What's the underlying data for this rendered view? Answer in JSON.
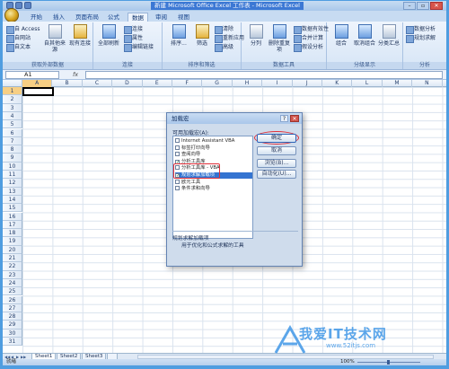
{
  "window": {
    "title": "新建 Microsoft Office Excel 工作表 - Microsoft Excel",
    "minimize": "–",
    "restore": "▫",
    "close": "✕"
  },
  "tabs": [
    "开始",
    "插入",
    "页面布局",
    "公式",
    "数据",
    "审阅",
    "视图"
  ],
  "active_tab": "数据",
  "ribbon": {
    "group1": {
      "items": [
        "自 Access",
        "自网站",
        "自文本"
      ],
      "big": "自其他来源",
      "big2": "现有连接",
      "label": "获取外部数据"
    },
    "group2": {
      "big": "全部刷新",
      "items": [
        "连接",
        "属性",
        "编辑链接"
      ],
      "label": "连接"
    },
    "group3": {
      "big": "排序...",
      "items": [
        "清除",
        "重新应用",
        "高级"
      ],
      "filter": "筛选",
      "label": "排序和筛选"
    },
    "group4": {
      "big1": "分列",
      "big2": "删除重复项",
      "items": [
        "数据有效性",
        "合并计算",
        "假设分析"
      ],
      "label": "数据工具"
    },
    "group5": {
      "big1": "组合",
      "big2": "取消组合",
      "big3": "分类汇总",
      "label": "分级显示"
    },
    "group6": {
      "items": [
        "数据分析",
        "规划求解"
      ],
      "label": "分析"
    }
  },
  "formula_bar": {
    "name_box": "A1",
    "fx": "fx",
    "value": ""
  },
  "columns": [
    "A",
    "B",
    "C",
    "D",
    "E",
    "F",
    "G",
    "H",
    "I",
    "J",
    "K",
    "L",
    "M",
    "N"
  ],
  "rows": [
    "1",
    "2",
    "3",
    "4",
    "5",
    "6",
    "7",
    "8",
    "9",
    "10",
    "11",
    "12",
    "13",
    "14",
    "15",
    "16",
    "17",
    "18",
    "19",
    "20",
    "21",
    "22",
    "23",
    "24",
    "25",
    "26",
    "27",
    "28",
    "29",
    "30",
    "31"
  ],
  "dialog": {
    "title": "加载宏",
    "help": "?",
    "close": "✕",
    "list_label": "可用加载宏(A):",
    "items": [
      {
        "label": "Internet Assistant VBA",
        "checked": false
      },
      {
        "label": "标签打印向导",
        "checked": false
      },
      {
        "label": "查阅向导",
        "checked": false
      },
      {
        "label": "分析工具库",
        "checked": true
      },
      {
        "label": "分析工具库 - VBA",
        "checked": false
      },
      {
        "label": "规划求解加载项",
        "checked": true
      },
      {
        "label": "欧元工具",
        "checked": false
      },
      {
        "label": "条件求和向导",
        "checked": false
      }
    ],
    "buttons": {
      "ok": "确定",
      "cancel": "取消",
      "browse": "浏览(B)...",
      "automation": "自动化(U)..."
    },
    "desc_title": "规划求解加载项",
    "desc": "用于优化和公式求解的工具"
  },
  "sheets": [
    "Sheet1",
    "Sheet2",
    "Sheet3"
  ],
  "nav_arrows": [
    "◀◀",
    "◀",
    "▶",
    "▶▶"
  ],
  "status": {
    "ready": "就绪",
    "zoom": "100%"
  },
  "watermark": {
    "text": "我爱IT技术网",
    "url": "www.52itjs.com"
  }
}
